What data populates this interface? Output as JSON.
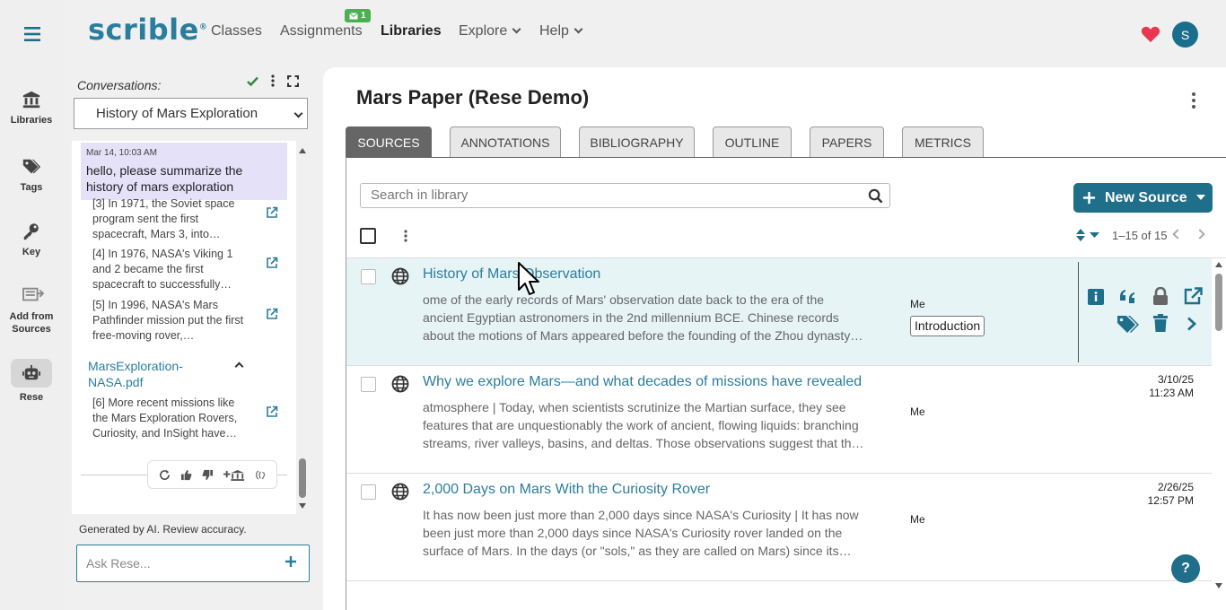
{
  "rail": {
    "items": [
      {
        "label": "Libraries",
        "icon": "library-icon"
      },
      {
        "label": "Tags",
        "icon": "tags-icon"
      },
      {
        "label": "Key",
        "icon": "key-icon"
      },
      {
        "label": "Add from Sources",
        "icon": "add-from-sources-icon"
      },
      {
        "label": "Rese",
        "icon": "robot-icon"
      }
    ]
  },
  "nav": {
    "logo": "scrible",
    "logo_mark": "®",
    "links": [
      "Classes",
      "Assignments",
      "Libraries",
      "Explore",
      "Help"
    ],
    "active": "Libraries",
    "assignments_badge": "1",
    "avatar_initial": "S"
  },
  "chat": {
    "conversations_label": "Conversations:",
    "selected_conversation": "History of Mars Exploration",
    "user_message": {
      "time": "Mar 14, 10:03 AM",
      "text": "hello, please summarize the history of mars exploration"
    },
    "citations": [
      "[3] In 1971, the Soviet space program sent the first spacecraft, Mars 3, into…",
      "[4] In 1976, NASA's Viking 1 and 2 became the first spacecraft to successfully…",
      "[5] In 1996, NASA's Mars Pathfinder mission put the first free-moving rover,…"
    ],
    "source_file": "MarsExploration-NASA.pdf",
    "source_citation": "[6] More recent missions like the Mars Exploration Rovers, Curiosity, and InSight have…",
    "disclaimer": "Generated by AI. Review accuracy.",
    "ask_placeholder": "Ask Rese..."
  },
  "main": {
    "title": "Mars Paper (Rese Demo)",
    "tabs": [
      "SOURCES",
      "ANNOTATIONS",
      "BIBLIOGRAPHY",
      "OUTLINE",
      "PAPERS",
      "METRICS"
    ],
    "active_tab": "SOURCES",
    "search_placeholder": "Search in library",
    "new_source_label": "New Source",
    "pager_text": "1–15 of 15",
    "sources": [
      {
        "title": "History of Mars Observation",
        "snippet": "ome of the early records of Mars' observation date back to the era of the ancient Egyptian astronomers in the 2nd millennium BCE. Chinese records about the motions of Mars appeared before the founding of the Zhou dynasty…",
        "owner": "Me",
        "tag": "Introduction",
        "date": "",
        "time": ""
      },
      {
        "title": "Why we explore Mars—and what decades of missions have revealed",
        "snippet": "atmosphere | Today, when scientists scrutinize the Martian surface, they see features that are unquestionably the work of ancient, flowing liquids: branching streams, river valleys, basins, and deltas. Those observations suggest that th…",
        "owner": "Me",
        "tag": "",
        "date": "3/10/25",
        "time": "11:23 AM"
      },
      {
        "title": "2,000 Days on Mars With the Curiosity Rover",
        "snippet": "It has now been just more than 2,000 days since NASA's Curiosity | It has now been just more than 2,000 days since NASA's Curiosity rover landed on the surface of Mars. In the days (or \"sols,\" as they are called on Mars) since its…",
        "owner": "Me",
        "tag": "",
        "date": "2/26/25",
        "time": "12:57 PM"
      }
    ],
    "help_label": "?"
  },
  "colors": {
    "brand": "#2b7d9e",
    "primary_button": "#1f6e8a",
    "highlight_row": "#e6f4f6",
    "user_bubble": "#e4e1f9",
    "badge_green": "#4caf50",
    "heart": "#e8384f"
  }
}
